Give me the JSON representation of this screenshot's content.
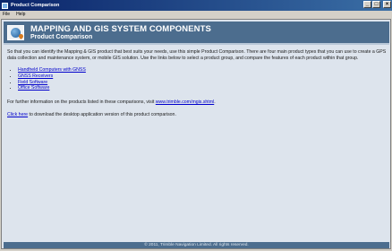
{
  "window": {
    "title": "Product Comparison",
    "controls": {
      "minimize": "_",
      "maximize": "□",
      "close": "×"
    }
  },
  "menu": {
    "items": [
      "File",
      "Help"
    ]
  },
  "banner": {
    "title": "MAPPING AND GIS SYSTEM COMPONENTS",
    "subtitle": "Product Comparison",
    "logo_icon": "globe-pin-icon"
  },
  "content": {
    "intro": "So that you can identify the Mapping & GIS product that best suits your needs, use this simple Product Comparison. There are four main product types that you can use to create a GPS data collection and maintenance system, or mobile GIS solution. Use the links below to select a product group, and compare the features of each product within that group.",
    "links": [
      "Handheld Computers with GNSS",
      "GNSS Receivers",
      "Field Software",
      "Office Software"
    ],
    "info_prefix": "For further information on the products listed in these comparisons, visit ",
    "info_link": "www.trimble.com/mgis.shtml",
    "info_suffix": ".",
    "download_link": "Click here",
    "download_suffix": " to download the desktop application version of this product comparison."
  },
  "footer": {
    "text": "© 2011, Trimble Navigation Limited. All rights reserved."
  }
}
